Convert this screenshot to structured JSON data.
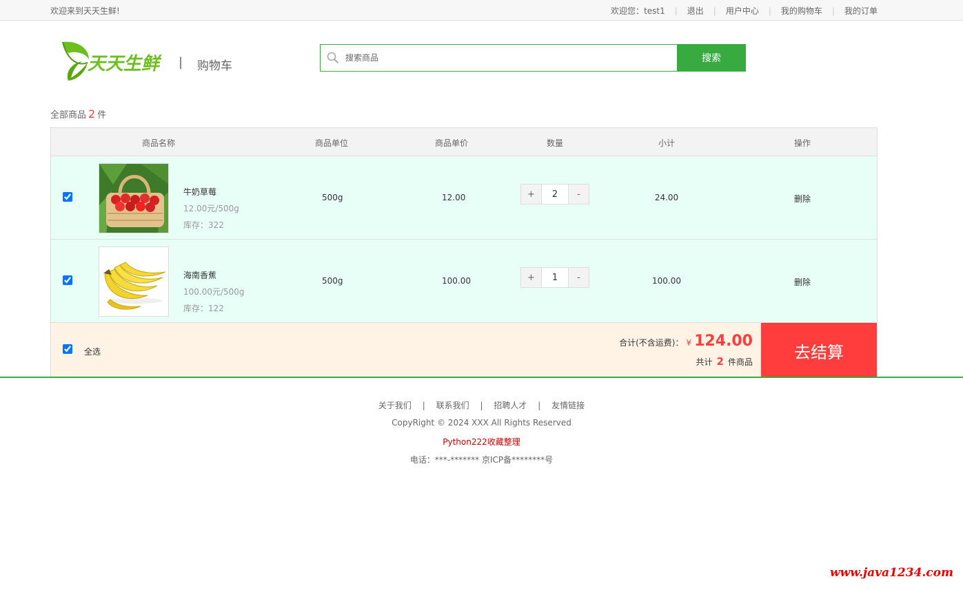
{
  "topbar": {
    "welcome": "欢迎来到天天生鲜!",
    "greeting_label": "欢迎您：",
    "username": "test1",
    "links": [
      "退出",
      "用户中心",
      "我的购物车",
      "我的订单"
    ]
  },
  "header": {
    "logo_text": "天天生鲜",
    "separator": "|",
    "page_name": "购物车"
  },
  "search": {
    "placeholder": "搜索商品",
    "button_label": "搜索"
  },
  "cart": {
    "total_label_prefix": "全部商品",
    "total_count": "2",
    "total_label_suffix": "件",
    "columns": [
      "商品名称",
      "商品单位",
      "商品单价",
      "数量",
      "小计",
      "操作"
    ],
    "items": [
      {
        "checked": true,
        "image": "strawberry-basket",
        "name": "牛奶草莓",
        "price_unit": "12.00元/500g",
        "stock": "库存：322",
        "unit": "500g",
        "price": "12.00",
        "quantity": "2",
        "subtotal": "24.00",
        "action": "删除"
      },
      {
        "checked": true,
        "image": "banana-bunch",
        "name": "海南香蕉",
        "price_unit": "100.00元/500g",
        "stock": "库存：122",
        "unit": "500g",
        "price": "100.00",
        "quantity": "1",
        "subtotal": "100.00",
        "action": "删除"
      }
    ],
    "plus_label": "+",
    "minus_label": "-",
    "select_all_label": "全选",
    "sum_label": "合计(不含运费)：",
    "currency": "¥",
    "sum_amount": "124.00",
    "count_prefix": "共计",
    "count_value": "2",
    "count_suffix": "件商品",
    "checkout_label": "去结算"
  },
  "footer": {
    "links": [
      "关于我们",
      "联系我们",
      "招聘人才",
      "友情链接"
    ],
    "separator": "|",
    "copyright": "CopyRight © 2024 XXX All Rights Reserved",
    "credit": "Python222收藏整理",
    "phone": "电话：***-******* 京ICP备********号"
  },
  "watermark": "www.java1234.com",
  "colors": {
    "brand_green": "#37ab40",
    "accent_red": "#ff3d3d",
    "row_bg": "#e8fff8",
    "summary_bg": "#fff3e6"
  }
}
